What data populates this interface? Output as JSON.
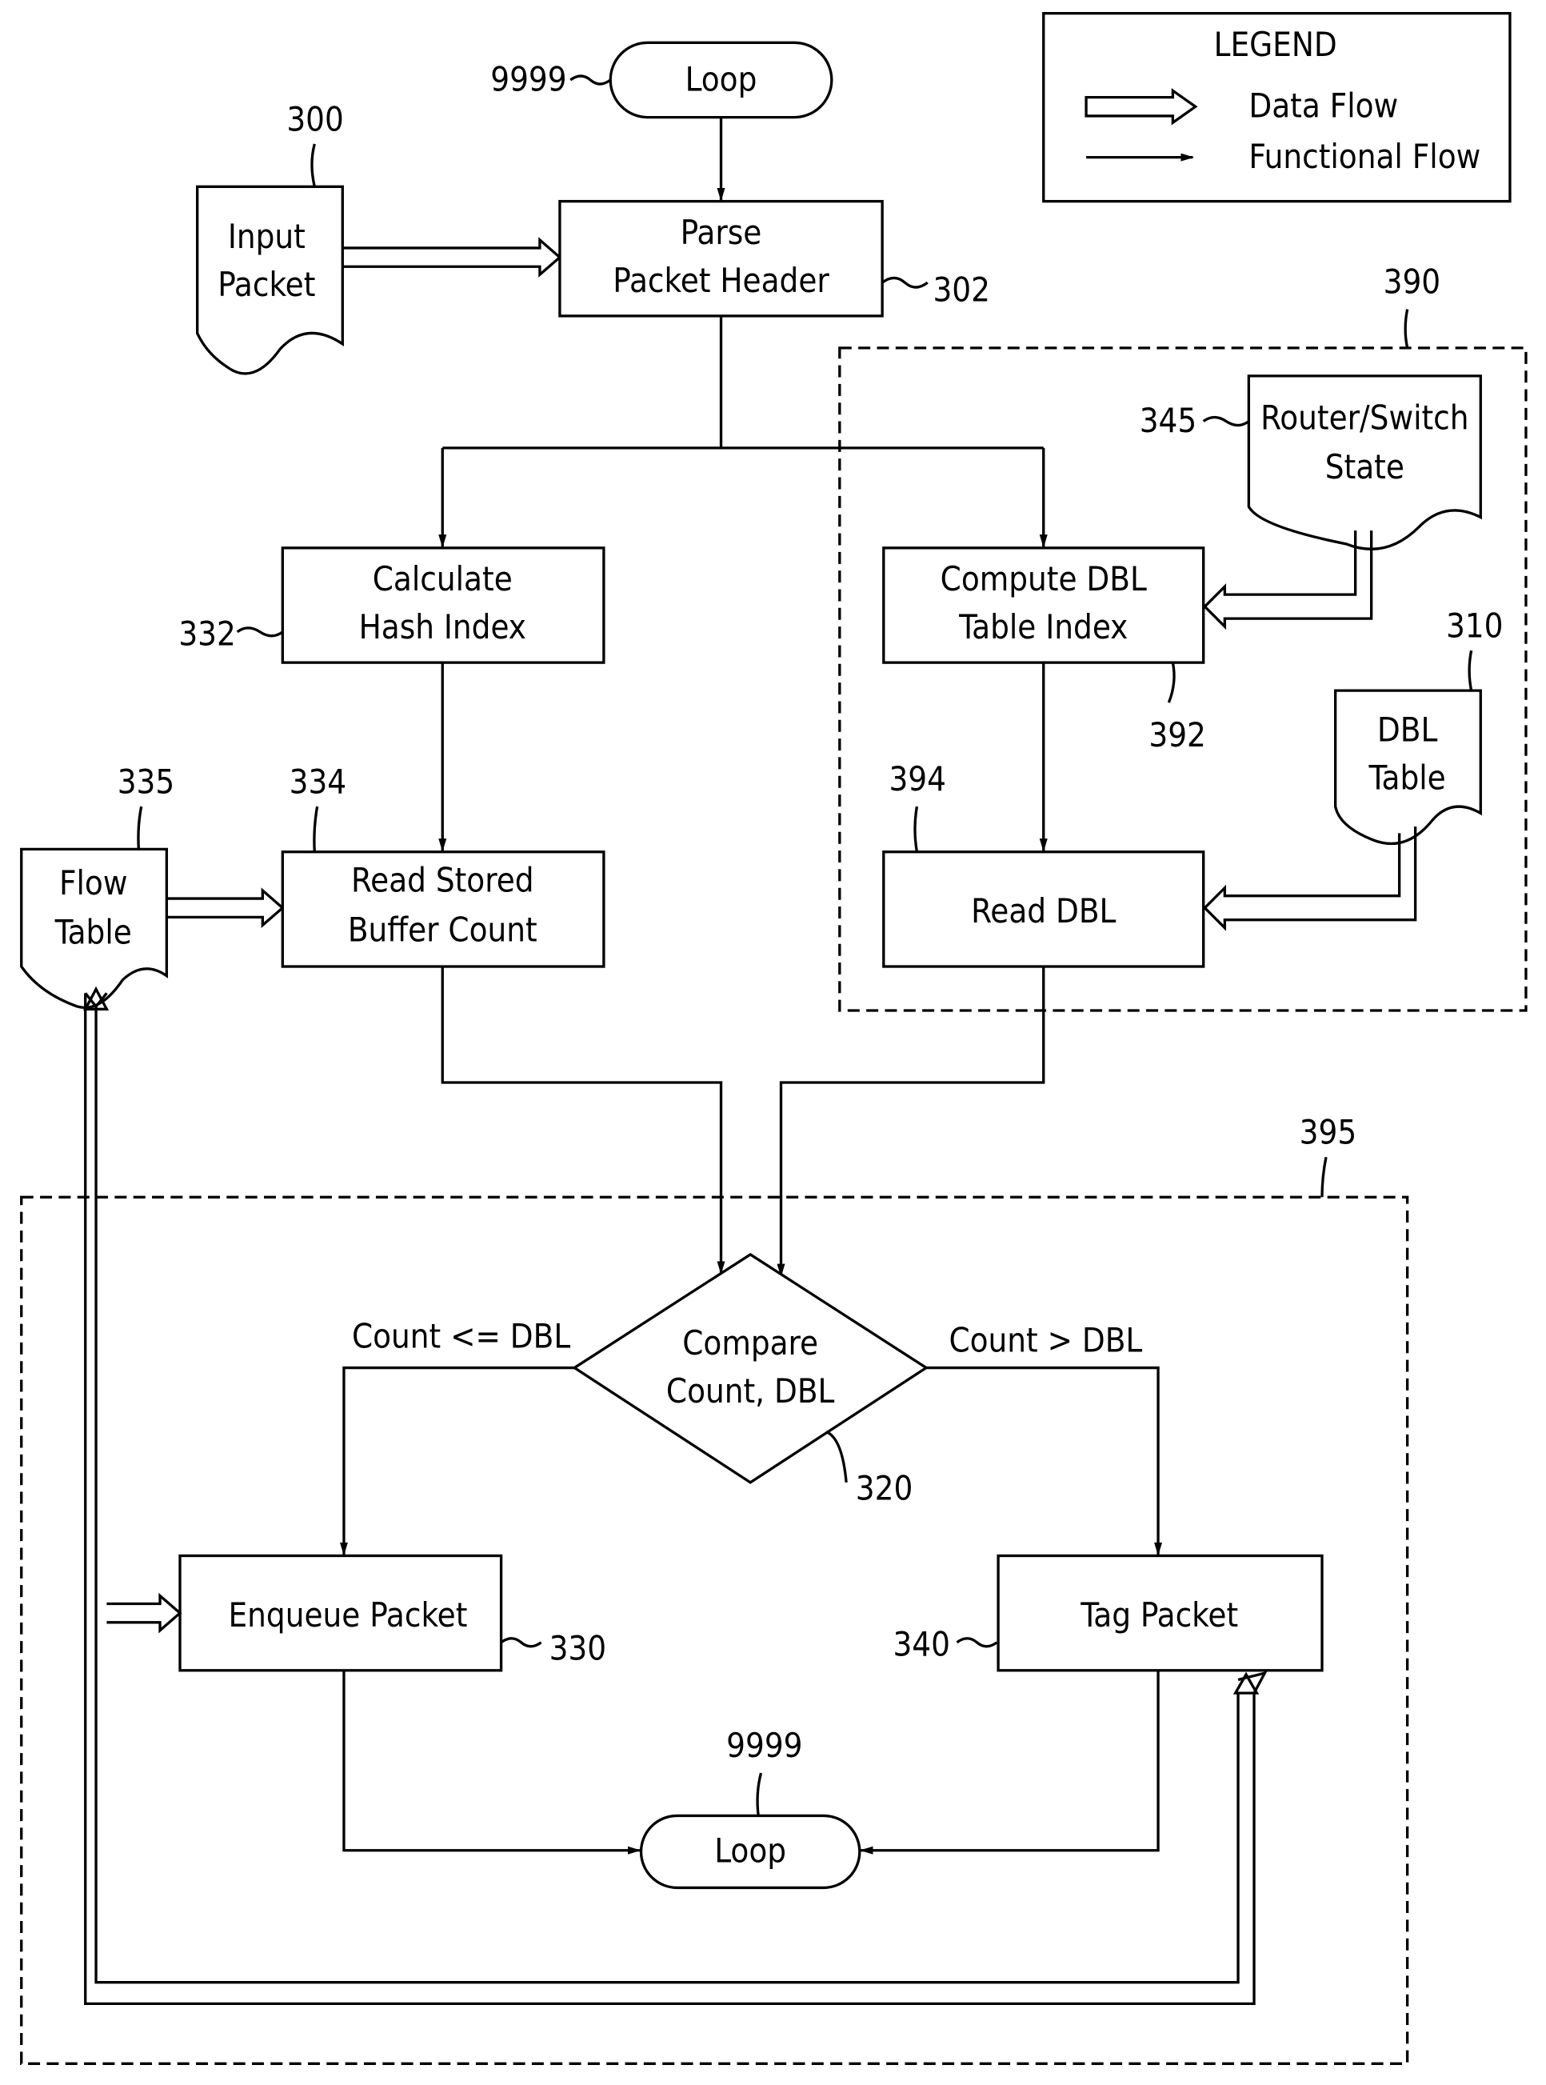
{
  "legend": {
    "title": "LEGEND",
    "items": [
      {
        "label": "Data Flow",
        "style": "hollow-double-arrow"
      },
      {
        "label": "Functional Flow",
        "style": "single-line-arrow"
      }
    ]
  },
  "nodes": {
    "loop_top": {
      "label": "Loop",
      "ref": "9999"
    },
    "input_packet": {
      "label_lines": [
        "Input",
        "Packet"
      ],
      "ref": "300"
    },
    "parse_header": {
      "label_lines": [
        "Parse",
        "Packet Header"
      ],
      "ref": "302"
    },
    "calc_hash": {
      "label_lines": [
        "Calculate",
        "Hash Index"
      ],
      "ref": "332"
    },
    "compute_dbl": {
      "label_lines": [
        "Compute DBL",
        "Table Index"
      ],
      "ref": "392"
    },
    "router_state": {
      "label_lines": [
        "Router/Switch",
        "State"
      ],
      "ref": "345"
    },
    "dbl_table": {
      "label_lines": [
        "DBL",
        "Table"
      ],
      "ref": "310"
    },
    "flow_table": {
      "label_lines": [
        "Flow",
        "Table"
      ],
      "ref": "335"
    },
    "read_count": {
      "label_lines": [
        "Read Stored",
        "Buffer Count"
      ],
      "ref": "334"
    },
    "read_dbl": {
      "label": "Read DBL",
      "ref": "394"
    },
    "compare": {
      "label_lines": [
        "Compare",
        "Count, DBL"
      ],
      "ref": "320"
    },
    "enqueue": {
      "label": "Enqueue Packet",
      "ref": "330"
    },
    "tag": {
      "label": "Tag Packet",
      "ref": "340"
    },
    "loop_bottom": {
      "label": "Loop",
      "ref": "9999"
    }
  },
  "groups": {
    "dbl_group": {
      "ref": "390"
    },
    "decision_group": {
      "ref": "395"
    }
  },
  "edges": {
    "le_label": "Count <= DBL",
    "gt_label": "Count > DBL"
  }
}
